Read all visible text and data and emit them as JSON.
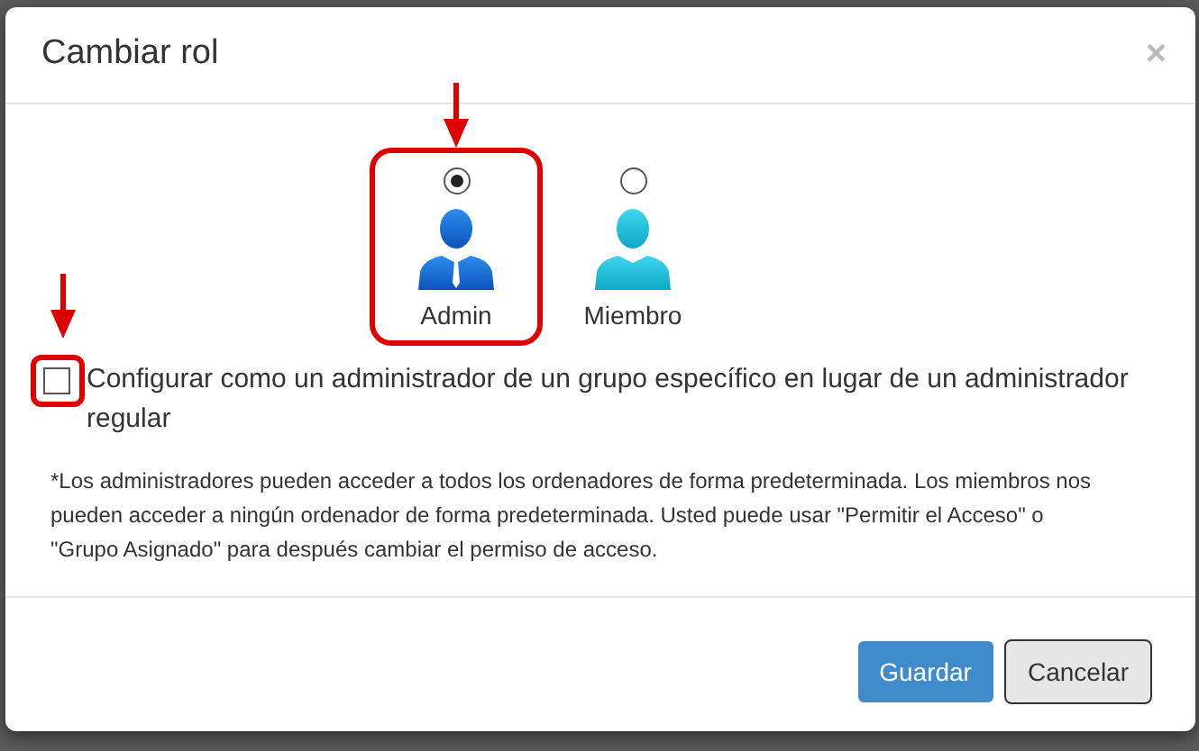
{
  "dialog": {
    "title": "Cambiar rol",
    "close": "×",
    "roles": [
      {
        "label": "Admin",
        "kind": "admin",
        "selected": true,
        "highlighted": true
      },
      {
        "label": "Miembro",
        "kind": "member",
        "selected": false,
        "highlighted": false
      }
    ],
    "group_admin": {
      "label": "Configurar como un administrador de un grupo específico en lugar de un administrador regular",
      "checked": false,
      "highlighted": true
    },
    "note": "*Los administradores pueden acceder a todos los ordenadores de forma predeterminada. Los miembros nos pueden acceder a ningún ordenador de forma predeterminada. Usted puede usar \"Permitir el Acceso\" o \"Grupo Asignado\" para después cambiar el permiso de acceso.",
    "buttons": [
      {
        "label": "Guardar",
        "kind": "primary"
      },
      {
        "label": "Cancelar",
        "kind": "default"
      }
    ]
  }
}
